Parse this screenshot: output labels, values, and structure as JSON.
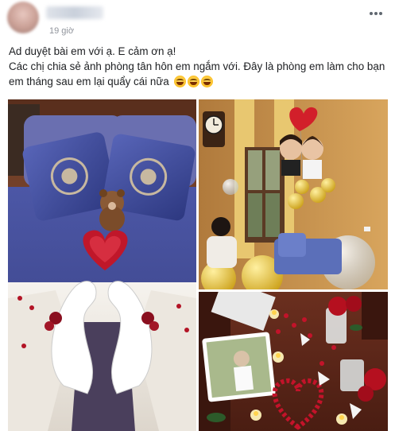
{
  "post": {
    "timestamp": "19 giờ",
    "paragraphs": [
      "Ad duyệt bài em với ạ. E cảm ơn ạ!",
      "Các chị chia sẻ ảnh phòng tân hôn em ngắm với. Đây là phòng em làm cho bạn em tháng sau em lại quẩy cái nữa"
    ],
    "emojis": [
      "grinning-squinting-face",
      "grinning-squinting-face",
      "grinning-squinting-face"
    ],
    "photos": [
      {
        "subject": "bed with blue pillows, teddy bear, rose petal heart and towel swans"
      },
      {
        "subject": "living room with clock, red heart balloon, bride-and-groom balloons, gold balloons"
      },
      {
        "subject": "table with rose petals, candles, photo frame and red roses"
      }
    ]
  },
  "icons": {
    "more": "more-horizontal-icon",
    "emoji": "laughing-emoji-icon"
  }
}
